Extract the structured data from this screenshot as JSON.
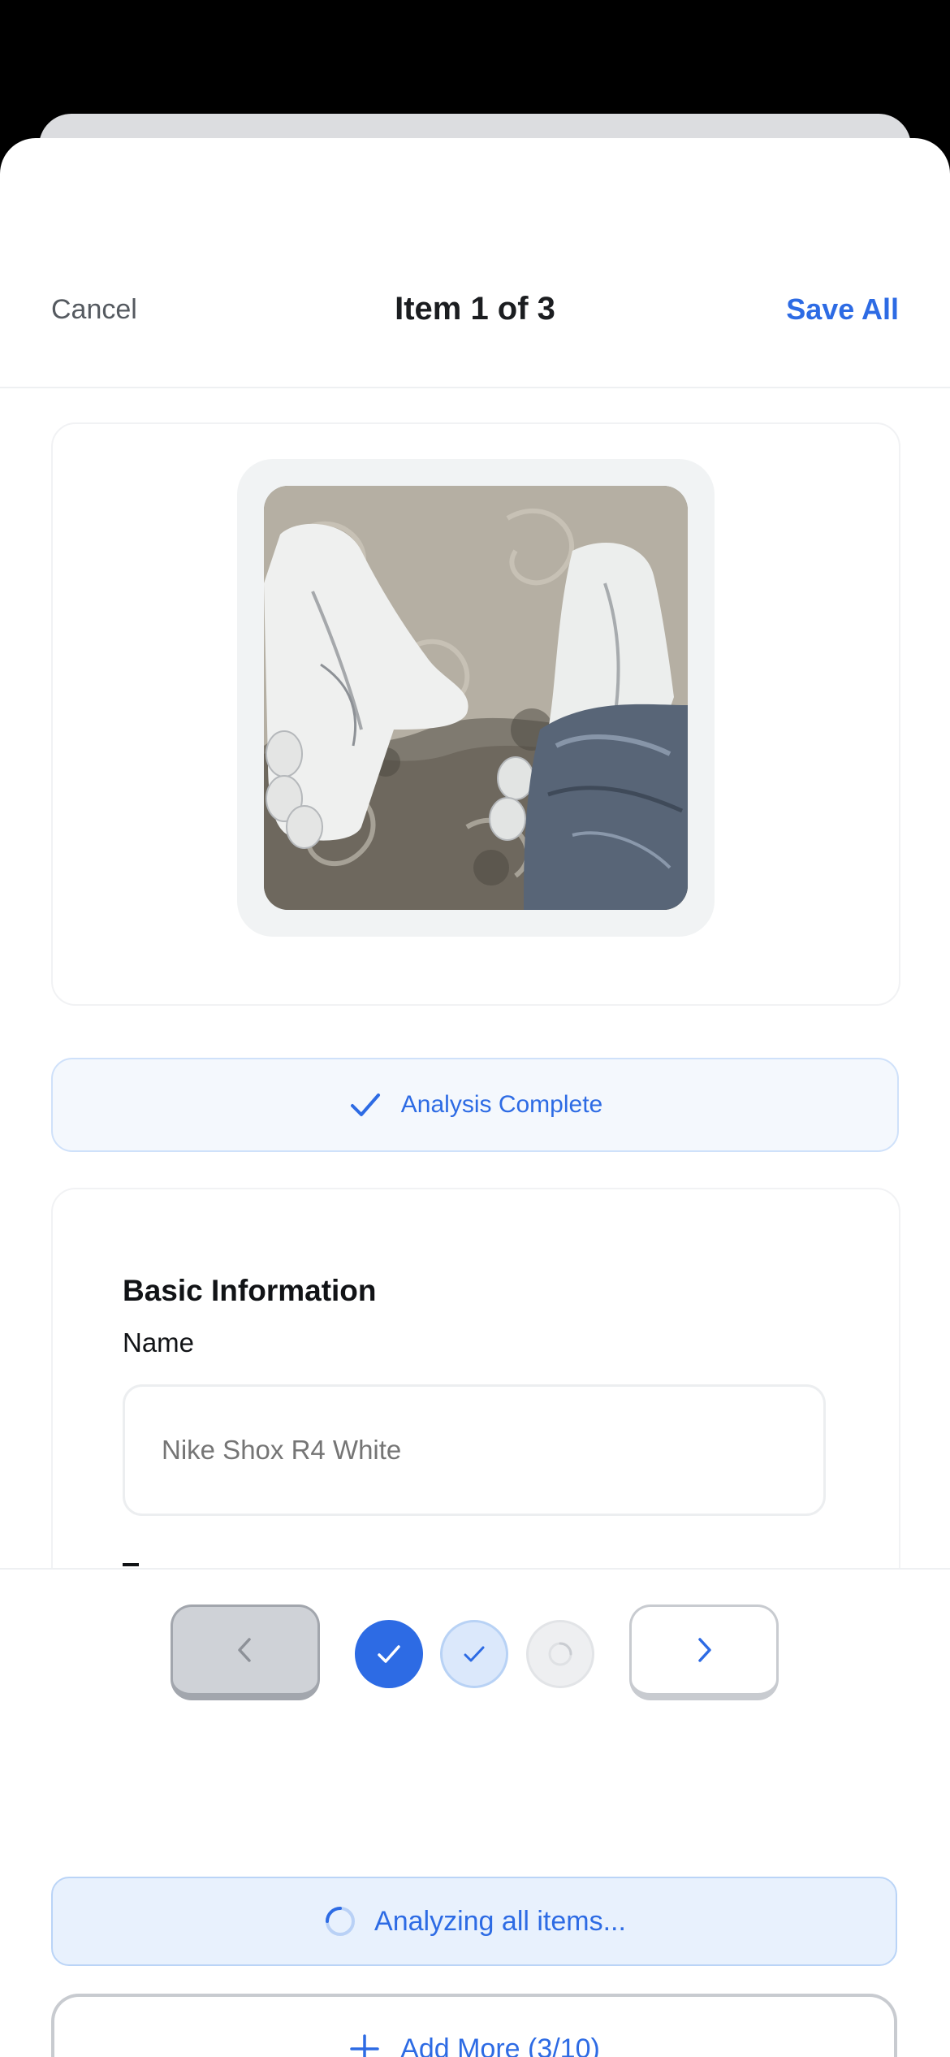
{
  "header": {
    "cancel_label": "Cancel",
    "title": "Item 1 of 3",
    "save_label": "Save All"
  },
  "photo": {
    "subject": "white sneakers on patterned rug"
  },
  "analysis": {
    "status_text": "Analysis Complete",
    "icon": "check-icon"
  },
  "basic_info": {
    "section_title": "Basic Information",
    "name_label": "Name",
    "name_placeholder": "Nike Shox R4 White",
    "name_value": ""
  },
  "pager": {
    "prev_icon": "chevron-left-icon",
    "next_icon": "chevron-right-icon",
    "dots": [
      {
        "state": "complete-active",
        "icon": "check-icon"
      },
      {
        "state": "complete",
        "icon": "check-icon"
      },
      {
        "state": "loading",
        "icon": "spinner-icon"
      }
    ]
  },
  "status": {
    "analyzing_text": "Analyzing all items..."
  },
  "add_more": {
    "label": "Add More (3/10)",
    "icon": "plus-icon"
  },
  "colors": {
    "accent": "#2d6be4",
    "accent_light": "#e8f1fd",
    "muted": "#555a60"
  }
}
